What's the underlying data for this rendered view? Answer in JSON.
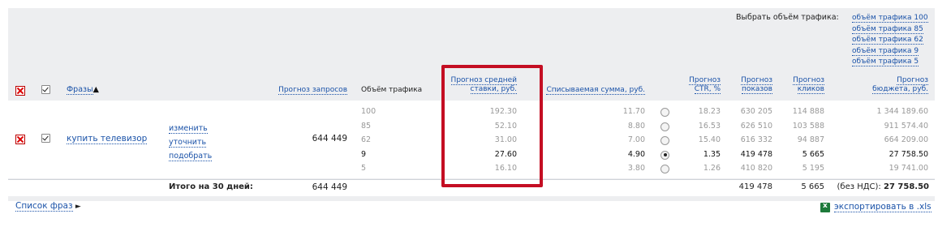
{
  "traffic_selector": {
    "label": "Выбрать объём трафика:",
    "options": [
      "объём трафика 100",
      "объём трафика 85",
      "объём трафика 62",
      "объём трафика 9",
      "объём трафика 5"
    ]
  },
  "columns": {
    "phrases": "Фразы",
    "sort_arrow": "▲",
    "forecast_queries": "Прогноз запросов",
    "traffic_volume": "Объём трафика",
    "avg_bid_line1": "Прогноз средней",
    "avg_bid_line2": "ставки, руб.",
    "charged_sum": "Списываемая сумма, руб.",
    "ctr_line1": "Прогноз",
    "ctr_line2": "CTR, %",
    "impressions_line1": "Прогноз",
    "impressions_line2": "показов",
    "clicks_line1": "Прогноз",
    "clicks_line2": "кликов",
    "budget_line1": "Прогноз",
    "budget_line2": "бюджета, руб."
  },
  "phrase_row": {
    "phrase": "купить телевизор",
    "actions": [
      "изменить",
      "уточнить",
      "подобрать"
    ],
    "queries": "644 449",
    "selected_index": 3,
    "volumes": [
      {
        "traffic": "100",
        "bid": "192.30",
        "charged": "11.70",
        "ctr": "18.23",
        "impressions": "630 205",
        "clicks": "114 888",
        "budget": "1 344 189.60"
      },
      {
        "traffic": "85",
        "bid": "52.10",
        "charged": "8.80",
        "ctr": "16.53",
        "impressions": "626 510",
        "clicks": "103 588",
        "budget": "911 574.40"
      },
      {
        "traffic": "62",
        "bid": "31.00",
        "charged": "7.00",
        "ctr": "15.40",
        "impressions": "616 332",
        "clicks": "94 887",
        "budget": "664 209.00"
      },
      {
        "traffic": "9",
        "bid": "27.60",
        "charged": "4.90",
        "ctr": "1.35",
        "impressions": "419 478",
        "clicks": "5 665",
        "budget": "27 758.50"
      },
      {
        "traffic": "5",
        "bid": "16.10",
        "charged": "3.80",
        "ctr": "1.26",
        "impressions": "410 820",
        "clicks": "5 195",
        "budget": "19 741.00"
      }
    ]
  },
  "totals": {
    "label": "Итого на 30 дней:",
    "queries": "644 449",
    "impressions": "419 478",
    "clicks": "5 665",
    "budget_prefix": "(без НДС):",
    "budget": "27 758.50"
  },
  "footer": {
    "phrase_list": "Список фраз",
    "arrow": "►",
    "export": "экспортировать в .xls"
  }
}
